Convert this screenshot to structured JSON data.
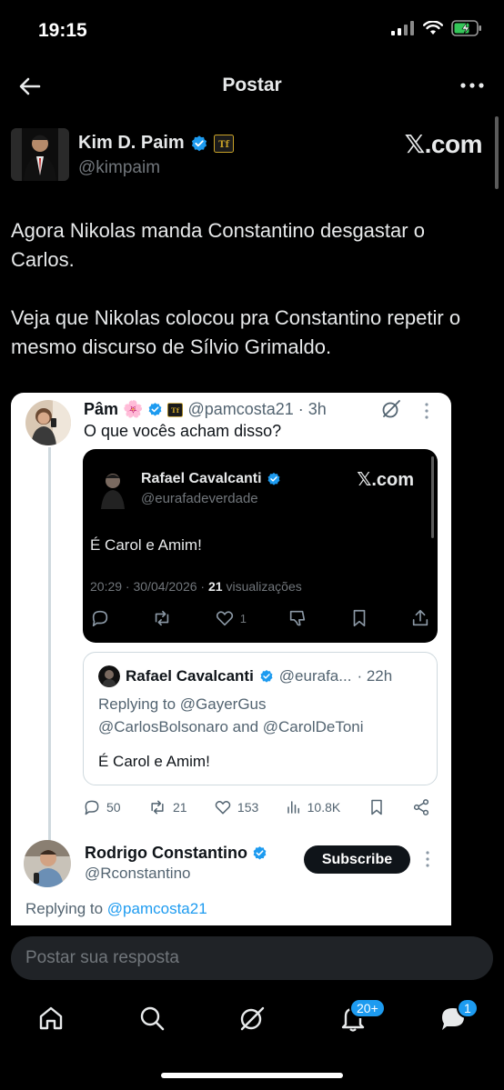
{
  "status_bar": {
    "time": "19:15"
  },
  "nav": {
    "title": "Postar"
  },
  "author": {
    "name": "Kim D. Paim",
    "handle": "@kimpaim",
    "badge_text": "𝕏.com"
  },
  "post": {
    "paragraph1": "Agora Nikolas manda Constantino desgastar o Carlos.",
    "paragraph2": "Veja que Nikolas colocou pra Constantino repetir o mesmo discurso de Sílvio Grimaldo."
  },
  "card": {
    "pam": {
      "name": "Pâm",
      "flower": "🌸",
      "handle": "@pamcosta21",
      "time": "· 3h",
      "text": "O que vocês acham disso?"
    },
    "embedded": {
      "name": "Rafael Cavalcanti",
      "handle": "@eurafadeverdade",
      "xcom": "𝕏.com",
      "text": "É Carol e Amim!",
      "meta_date": "20:29 · 30/04/2026 · ",
      "meta_views": "21",
      "meta_views_label": " visualizações",
      "likes": "1"
    },
    "quote": {
      "name": "Rafael Cavalcanti",
      "handle": "@eurafa...",
      "time": "· 22h",
      "replying_line1": "Replying to @GayerGus",
      "replying_line2": "@CarlosBolsonaro and @CarolDeToni",
      "text": "É Carol e Amim!"
    },
    "engagement": {
      "replies": "50",
      "reposts": "21",
      "likes": "153",
      "views": "10.8K"
    },
    "reply": {
      "name": "Rodrigo Constantino",
      "handle": "@Rconstantino",
      "subscribe_label": "Subscribe",
      "replying_prefix": "Replying to ",
      "replying_handle": "@pamcosta21"
    }
  },
  "composer": {
    "placeholder": "Postar sua resposta"
  },
  "bottom_nav": {
    "notifications_badge": "20+",
    "messages_badge": "1",
    "icons": [
      "home-icon",
      "search-icon",
      "grok-icon",
      "bell-icon",
      "messages-icon"
    ]
  },
  "colors": {
    "accent": "#1d9bf0",
    "background": "#000000",
    "card": "#ffffff"
  }
}
